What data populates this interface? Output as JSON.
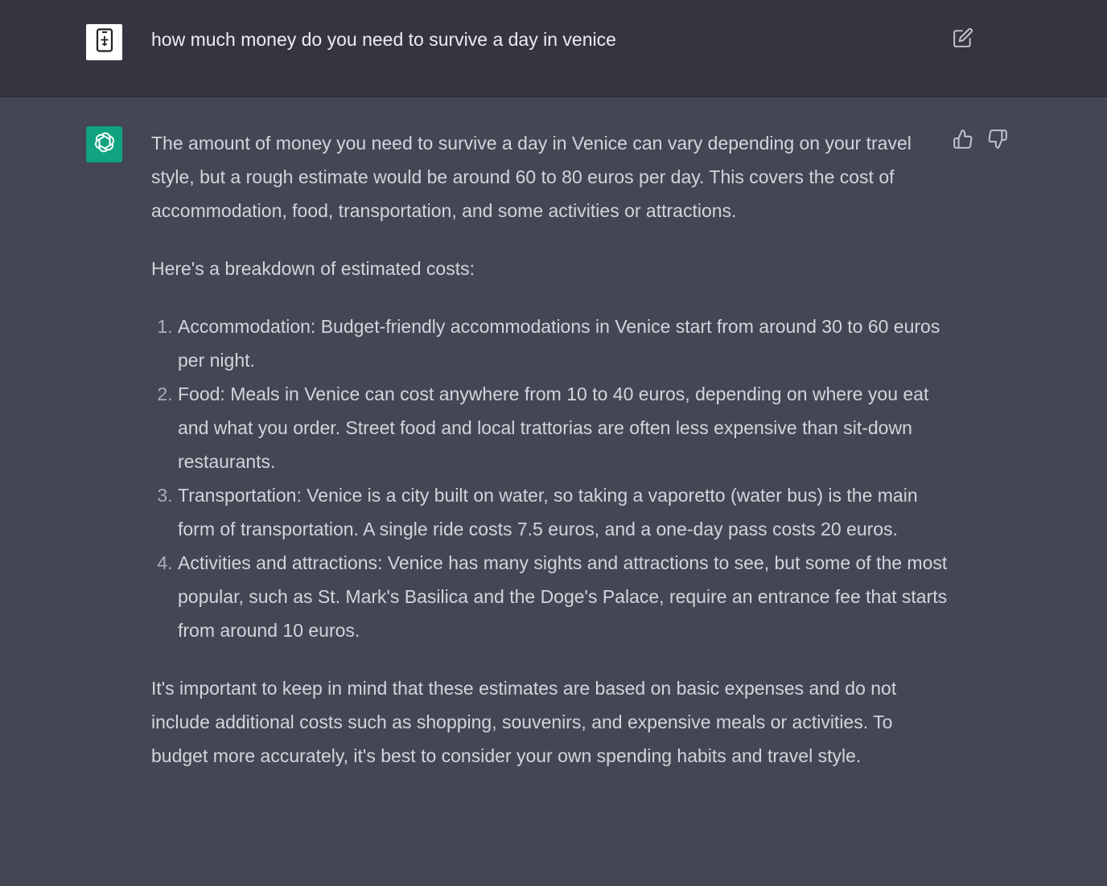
{
  "user_message": {
    "avatar_icon": "phone-icon",
    "text": "how much money do you need to survive a day in venice",
    "edit_icon": "edit-icon"
  },
  "assistant_message": {
    "avatar_icon": "openai-logo-icon",
    "intro": "The amount of money you need to survive a day in Venice can vary depending on your travel style, but a rough estimate would be around 60 to 80 euros per day. This covers the cost of accommodation, food, transportation, and some activities or attractions.",
    "breakdown_heading": "Here's a breakdown of estimated costs:",
    "list": [
      "Accommodation: Budget-friendly accommodations in Venice start from around 30 to 60 euros per night.",
      "Food: Meals in Venice can cost anywhere from 10 to 40 euros, depending on where you eat and what you order. Street food and local trattorias are often less expensive than sit-down restaurants.",
      "Transportation: Venice is a city built on water, so taking a vaporetto (water bus) is the main form of transportation. A single ride costs 7.5 euros, and a one-day pass costs 20 euros.",
      "Activities and attractions: Venice has many sights and attractions to see, but some of the most popular, such as St. Mark's Basilica and the Doge's Palace, require an entrance fee that starts from around 10 euros."
    ],
    "conclusion": "It's important to keep in mind that these estimates are based on basic expenses and do not include additional costs such as shopping, souvenirs, and expensive meals or activities. To budget more accurately, it's best to consider your own spending habits and travel style.",
    "thumbs_up_icon": "thumbs-up-icon",
    "thumbs_down_icon": "thumbs-down-icon"
  },
  "colors": {
    "user_bg": "#343541",
    "assistant_bg": "#444654",
    "brand_green": "#10a37f",
    "text": "#d1d5db"
  }
}
